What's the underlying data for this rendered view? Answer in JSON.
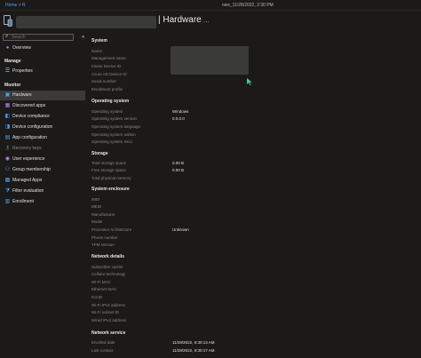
{
  "breadcrumb": {
    "home": "Home",
    "sep": ">",
    "next": "R",
    "tail": "ows_11/28/2022, 2:30 PM"
  },
  "header": {
    "title": "| Hardware",
    "more": "..."
  },
  "sidebar": {
    "search_placeholder": "Search",
    "overview": "Overview",
    "manage_title": "Manage",
    "properties": "Properties",
    "monitor_title": "Monitor",
    "items": [
      {
        "label": "Hardware",
        "icon": "hardware-icon"
      },
      {
        "label": "Discovered apps",
        "icon": "discovered-apps-icon"
      },
      {
        "label": "Device compliance",
        "icon": "compliance-icon"
      },
      {
        "label": "Device configuration",
        "icon": "configuration-icon"
      },
      {
        "label": "App configuration",
        "icon": "app-config-icon"
      },
      {
        "label": "Recovery keys",
        "icon": "key-icon"
      },
      {
        "label": "User experience",
        "icon": "user-experience-icon"
      },
      {
        "label": "Group membership",
        "icon": "group-icon"
      },
      {
        "label": "Managed Apps",
        "icon": "managed-apps-icon"
      },
      {
        "label": "Filter evaluation",
        "icon": "filter-icon"
      },
      {
        "label": "Enrollment",
        "icon": "enrollment-icon"
      }
    ]
  },
  "content": {
    "system": {
      "title": "System",
      "rows": [
        "Name",
        "Management name",
        "Intune Device ID",
        "Azure AD Device ID",
        "Serial number",
        "Enrollment profile"
      ]
    },
    "os": {
      "title": "Operating system",
      "rows": [
        {
          "label": "Operating system",
          "value": "Windows"
        },
        {
          "label": "Operating system version",
          "value": "0.0.0.0"
        },
        {
          "label": "Operating system language",
          "value": ""
        },
        {
          "label": "Operating system edition",
          "value": ""
        },
        {
          "label": "Operating system SKU",
          "value": ""
        }
      ]
    },
    "storage": {
      "title": "Storage",
      "rows": [
        {
          "label": "Total storage space",
          "value": "0.00 B"
        },
        {
          "label": "Free storage space",
          "value": "0.00 B"
        },
        {
          "label": "Total physical memory",
          "value": ""
        }
      ]
    },
    "enclosure": {
      "title": "System enclosure",
      "rows": [
        {
          "label": "IMEI",
          "value": ""
        },
        {
          "label": "MEID",
          "value": ""
        },
        {
          "label": "Manufacturer",
          "value": ""
        },
        {
          "label": "Model",
          "value": ""
        },
        {
          "label": "Processor Architecture",
          "value": "Unknown"
        },
        {
          "label": "Phone number",
          "value": ""
        },
        {
          "label": "TPM Version",
          "value": ""
        }
      ]
    },
    "network": {
      "title": "Network details",
      "rows": [
        "Subscriber carrier",
        "Cellular technology",
        "Wi-Fi MAC",
        "Ethernet MAC",
        "ICCID",
        "Wi-Fi IPv4 address",
        "Wi-Fi subnet ID",
        "Wired IPv4 address"
      ]
    },
    "service": {
      "title": "Network service",
      "rows": [
        {
          "label": "Enrolled date",
          "value": "11/28/2022, 9:30:13 AM"
        },
        {
          "label": "Last contact",
          "value": "11/28/2022, 9:30:17 AM"
        }
      ]
    }
  },
  "colors": {
    "accent": "#4ea1f3",
    "background": "#1b1a19",
    "active": "#3b3a39"
  }
}
